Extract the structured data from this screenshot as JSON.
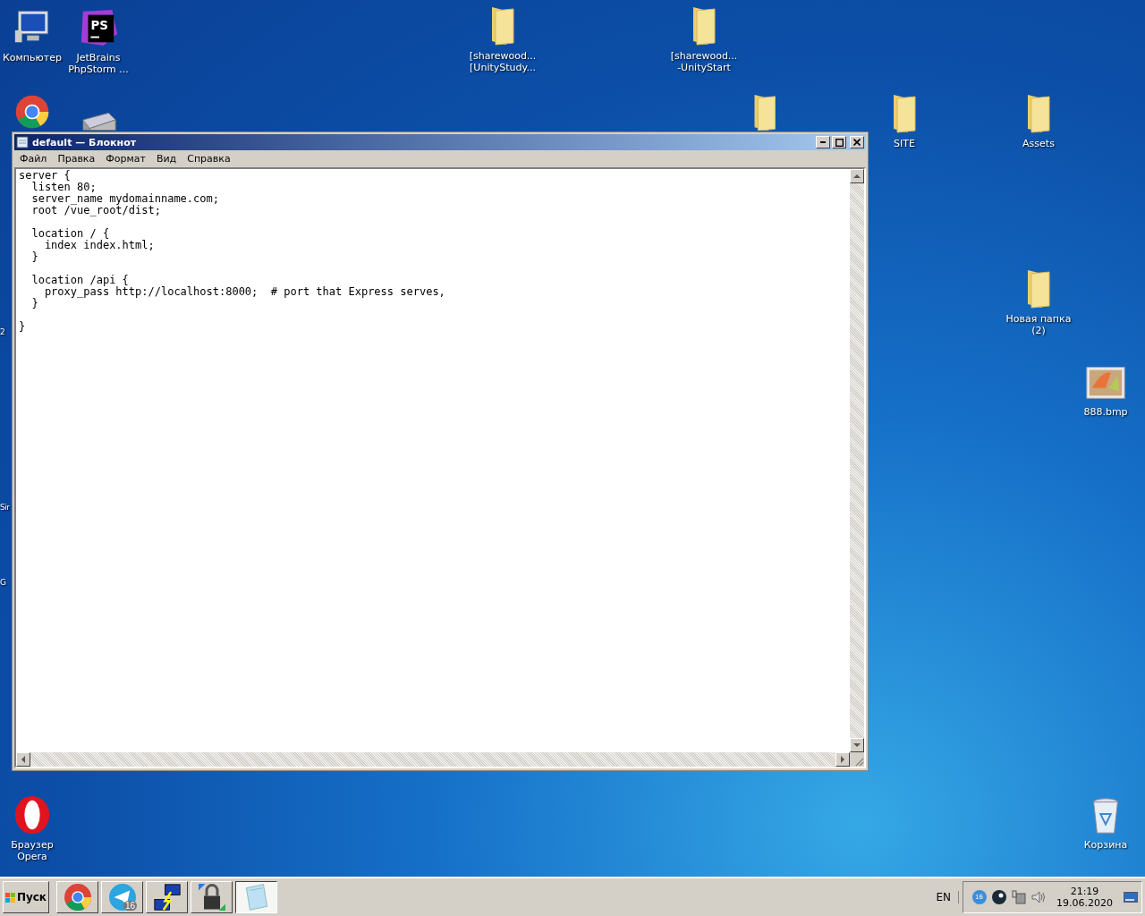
{
  "desktop": {
    "icons": [
      {
        "kind": "computer",
        "label": [
          "Компьютер"
        ]
      },
      {
        "kind": "phpstorm",
        "logo_text": "PS",
        "label": [
          "JetBrains",
          "PhpStorm ..."
        ]
      },
      {
        "kind": "folder",
        "label": [
          "[sharewood...",
          "[UnityStudy..."
        ]
      },
      {
        "kind": "folder",
        "label": [
          "[sharewood...",
          "-UnityStart"
        ]
      },
      {
        "kind": "chrome"
      },
      {
        "kind": "drive"
      },
      {
        "kind": "folder"
      },
      {
        "kind": "folder",
        "label": [
          "SITE"
        ]
      },
      {
        "kind": "folder",
        "label": [
          "Assets"
        ]
      },
      {
        "kind": "folder",
        "label": [
          "Новая папка",
          "(2)"
        ]
      },
      {
        "kind": "image",
        "label": [
          "888.bmp"
        ]
      },
      {
        "kind": "opera",
        "label": [
          "Браузер",
          "Opera"
        ]
      },
      {
        "kind": "recycle",
        "label": [
          "Корзина"
        ]
      }
    ],
    "edge_fragments": [
      "2",
      "Sir",
      "G"
    ]
  },
  "window": {
    "title": "default — Блокнот",
    "menu": [
      "Файл",
      "Правка",
      "Формат",
      "Вид",
      "Справка"
    ],
    "blocks": [
      [
        "server {",
        "  listen 80;",
        "  server_name mydomainname.com;",
        "  root /vue_root/dist;"
      ],
      [
        "  location / {",
        "    index index.html;",
        "  }"
      ],
      [
        "  location /api {",
        "    proxy_pass http://localhost:8000;  # port that Express serves,",
        "  }"
      ],
      [
        "}"
      ]
    ]
  },
  "taskbar": {
    "start": "Пуск",
    "buttons": [
      {
        "kind": "chrome",
        "selected": false
      },
      {
        "kind": "telegram",
        "selected": false,
        "badge": "16"
      },
      {
        "kind": "network",
        "selected": false
      },
      {
        "kind": "lock",
        "selected": false
      },
      {
        "kind": "notepad",
        "selected": true
      }
    ],
    "language": "EN",
    "tray": [
      {
        "kind": "update",
        "badge": "16"
      },
      {
        "kind": "steam"
      },
      {
        "kind": "network"
      },
      {
        "kind": "volume"
      }
    ],
    "time": "21:19",
    "date": "19.06.2020"
  }
}
